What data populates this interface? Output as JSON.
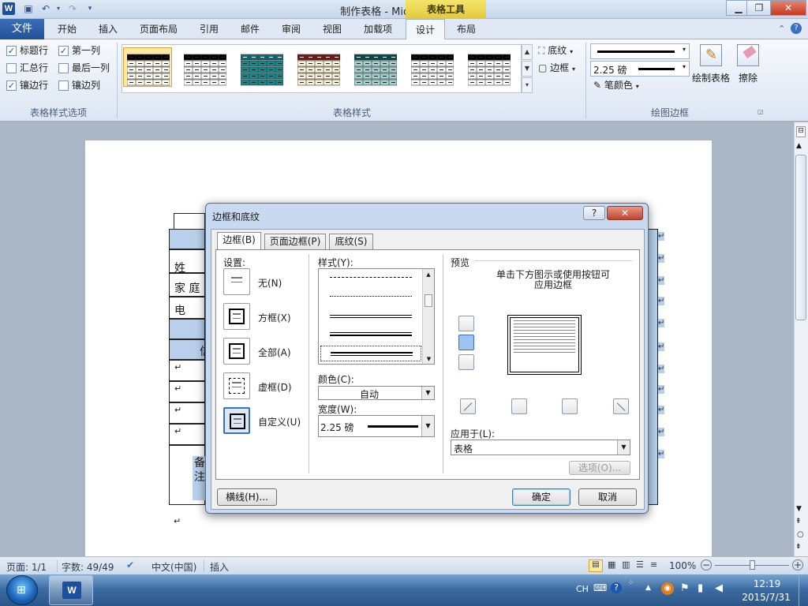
{
  "app": {
    "title": "制作表格 - Microsoft Word",
    "context_tab": "表格工具",
    "logo": "W"
  },
  "ribbon_tabs": [
    "开始",
    "插入",
    "页面布局",
    "引用",
    "邮件",
    "审阅",
    "视图",
    "加载项",
    "设计",
    "布局"
  ],
  "file_tab": "文件",
  "active_tab": "设计",
  "style_options": {
    "items": [
      {
        "label": "标题行",
        "checked": true
      },
      {
        "label": "第一列",
        "checked": true
      },
      {
        "label": "汇总行",
        "checked": false
      },
      {
        "label": "最后一列",
        "checked": false
      },
      {
        "label": "镶边行",
        "checked": true
      },
      {
        "label": "镶边列",
        "checked": false
      }
    ],
    "group_label": "表格样式选项"
  },
  "table_styles": {
    "group_label": "表格样式",
    "shading_label": "底纹",
    "borders_label": "边框",
    "styles": [
      {
        "name": "plain-grid",
        "header": "#000000",
        "fill": "#ffffff",
        "selected": true
      },
      {
        "name": "plain-grid-2",
        "header": "#000000",
        "fill": "#ffffff",
        "selected": false
      },
      {
        "name": "teal",
        "header": "#0e6b73",
        "fill": "#0f8a8f",
        "selected": false
      },
      {
        "name": "dark-red-header",
        "header": "#7a1212",
        "fill": "#fbf3cf",
        "selected": false
      },
      {
        "name": "teal-dots",
        "header": "#004d4d",
        "fill": "#9fd3cf",
        "selected": false
      },
      {
        "name": "plain-grid-3",
        "header": "#000000",
        "fill": "#ffffff",
        "selected": false
      },
      {
        "name": "simple-lines",
        "header": "#000000",
        "fill": "#ffffff",
        "selected": false
      }
    ]
  },
  "draw_borders": {
    "group_label": "绘图边框",
    "weight": "2.25 磅",
    "pen_color_label": "笔颜色",
    "draw_table_label": "绘制表格",
    "eraser_label": "擦除"
  },
  "document": {
    "cells": [
      "姓",
      "家 庭",
      "电",
      "信",
      "备",
      "注"
    ],
    "return_mark": "↵"
  },
  "dialog": {
    "title": "边框和底纹",
    "help": "?",
    "close": "✕",
    "tabs": [
      "边框(B)",
      "页面边框(P)",
      "底纹(S)"
    ],
    "settings_label": "设置:",
    "settings": [
      {
        "label": "无(N)",
        "selected": false
      },
      {
        "label": "方框(X)",
        "selected": false
      },
      {
        "label": "全部(A)",
        "selected": false
      },
      {
        "label": "虚框(D)",
        "selected": false
      },
      {
        "label": "自定义(U)",
        "selected": true
      }
    ],
    "style_label": "样式(Y):",
    "color_label": "颜色(C):",
    "color_value": "自动",
    "width_label": "宽度(W):",
    "width_value": "2.25 磅",
    "preview_label": "预览",
    "preview_hint_1": "单击下方图示或使用按钮可",
    "preview_hint_2": "应用边框",
    "apply_label": "应用于(L):",
    "apply_value": "表格",
    "options_button": "选项(O)...",
    "horizontal_line_button": "横线(H)...",
    "ok_button": "确定",
    "cancel_button": "取消"
  },
  "status": {
    "page": "页面: 1/1",
    "words": "字数: 49/49",
    "language": "中文(中国)",
    "mode": "插入",
    "zoom": "100%"
  },
  "tray": {
    "ime": "CH",
    "time": "12:19",
    "date": "2015/7/31"
  }
}
